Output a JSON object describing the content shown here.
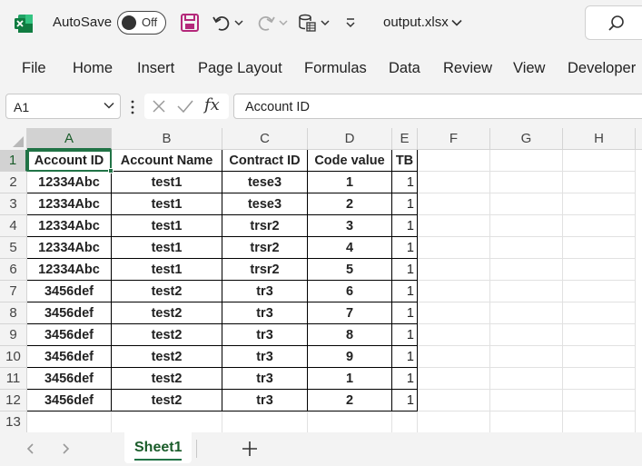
{
  "titlebar": {
    "autosave_label": "AutoSave",
    "autosave_state": "Off",
    "filename": "output.xlsx"
  },
  "ribbon": {
    "tabs": [
      "File",
      "Home",
      "Insert",
      "Page Layout",
      "Formulas",
      "Data",
      "Review",
      "View",
      "Developer"
    ]
  },
  "formula_bar": {
    "name_box": "A1",
    "fx_label": "fx",
    "formula_value": "Account ID"
  },
  "grid": {
    "columns": [
      "A",
      "B",
      "C",
      "D",
      "E",
      "F",
      "G",
      "H"
    ],
    "rows": [
      "1",
      "2",
      "3",
      "4",
      "5",
      "6",
      "7",
      "8",
      "9",
      "10",
      "11",
      "12",
      "13"
    ],
    "headers": [
      "Account ID",
      "Account Name",
      "Contract ID",
      "Code value",
      "TB"
    ],
    "data": [
      [
        "12334Abc",
        "test1",
        "tese3",
        "1",
        "1"
      ],
      [
        "12334Abc",
        "test1",
        "tese3",
        "2",
        "1"
      ],
      [
        "12334Abc",
        "test1",
        "trsr2",
        "3",
        "1"
      ],
      [
        "12334Abc",
        "test1",
        "trsr2",
        "4",
        "1"
      ],
      [
        "12334Abc",
        "test1",
        "trsr2",
        "5",
        "1"
      ],
      [
        "3456def",
        "test2",
        "tr3",
        "6",
        "1"
      ],
      [
        "3456def",
        "test2",
        "tr3",
        "7",
        "1"
      ],
      [
        "3456def",
        "test2",
        "tr3",
        "8",
        "1"
      ],
      [
        "3456def",
        "test2",
        "tr3",
        "9",
        "1"
      ],
      [
        "3456def",
        "test2",
        "tr3",
        "1",
        "1"
      ],
      [
        "3456def",
        "test2",
        "tr3",
        "2",
        "1"
      ]
    ]
  },
  "sheets": {
    "active": "Sheet1",
    "add_label": "+"
  },
  "colors": {
    "accent": "#217346",
    "excel_green": "#107c41"
  }
}
